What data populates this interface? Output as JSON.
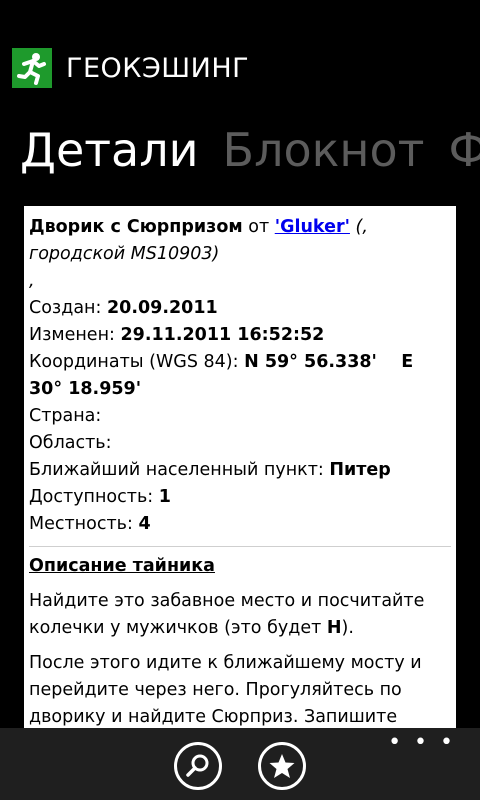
{
  "app": {
    "title": "ГЕОКЭШИНГ",
    "logo_icon": "running-man-icon"
  },
  "pivot": {
    "tabs": [
      "Детали",
      "Блокнот",
      "Фото"
    ],
    "active_index": 0
  },
  "cache": {
    "name": "Дворик с Сюрпризом",
    "by": "от",
    "owner": "'Gluker'",
    "type_line": "(, городской MS10903)",
    "comma_line": ",",
    "created_label": "Создан:",
    "created_value": "20.09.2011",
    "modified_label": "Изменен:",
    "modified_value": "29.11.2011 16:52:52",
    "coords_label": "Координаты (WGS 84):",
    "coords_value": "N 59° 56.338'    E 30° 18.959'",
    "country_label": "Страна:",
    "region_label": "Область:",
    "nearest_label": "Ближайший населенный пункт:",
    "nearest_value": "Питер",
    "difficulty_label": "Доступность:",
    "difficulty_value": "1",
    "terrain_label": "Местность:",
    "terrain_value": "4"
  },
  "description": {
    "heading": "Описание тайника",
    "para1_text": "Найдите это забавное место и посчитайте колечки у мужичков (это будет ",
    "para1_bold": "H",
    "para1_end": ").",
    "para2": "После этого идите к ближайшему мосту и перейдите через него. Прогуляйтесь по дворику и найдите Сюрприз. Запишите"
  },
  "appbar": {
    "buttons": [
      "search-icon",
      "favorite-star-icon"
    ],
    "more": "• • •"
  },
  "colors": {
    "logo_green": "#1e9a2c",
    "inactive_tab": "#5c5c5c",
    "link_blue": "#0000ee",
    "appbar_bg": "#1f1f1f"
  }
}
